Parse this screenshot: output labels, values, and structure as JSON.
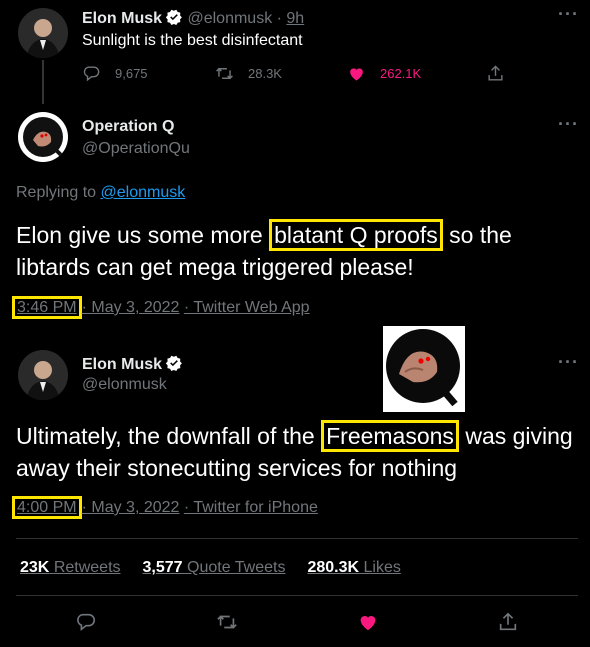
{
  "tweet1": {
    "name": "Elon Musk",
    "handle": "@elonmusk",
    "time": "9h",
    "text": "Sunlight is the best disinfectant",
    "replies": "9,675",
    "retweets": "28.3K",
    "likes": "262.1K"
  },
  "reply": {
    "name": "Operation Q",
    "handle": "@OperationQu",
    "replying_label": "Replying to",
    "replying_to": "@elonmusk",
    "text_before": "Elon give us some more ",
    "text_highlight": "blatant Q proofs",
    "text_after": " so the libtards can get mega triggered please!",
    "time": "3:46 PM",
    "date": "· May 3, 2022",
    "source": "· Twitter Web App"
  },
  "main": {
    "name": "Elon Musk",
    "handle": "@elonmusk",
    "text_before": "Ultimately, the downfall of the ",
    "text_highlight": "Freemasons",
    "text_after": " was giving away their stonecutting services for nothing",
    "time": "4:00 PM",
    "date": "· May 3, 2022",
    "source": "· Twitter for iPhone",
    "retweets_count": "23K",
    "retweets_label": "Retweets",
    "quotes_count": "3,577",
    "quotes_label": "Quote Tweets",
    "likes_count": "280.3K",
    "likes_label": "Likes"
  },
  "colors": {
    "like": "#f91880",
    "highlight": "#ffe600",
    "link": "#1d9bf0",
    "muted": "#71767b"
  },
  "icons": [
    "more-icon",
    "reply-icon",
    "retweet-icon",
    "like-icon",
    "share-icon",
    "verified-badge-icon"
  ]
}
